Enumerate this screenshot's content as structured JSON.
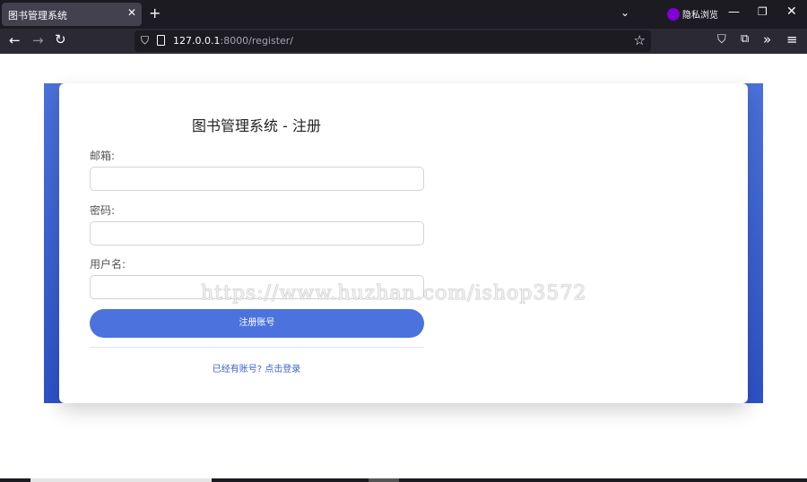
{
  "browser": {
    "tab_title": "图书管理系统",
    "tab_close": "✕",
    "new_tab": "+",
    "tabs_menu": "⌄",
    "private_label": "隐私浏览",
    "url_host": "127.0.0.1",
    "url_rest": ":8000/register/",
    "controls": {
      "minimize": "—",
      "maximize": "❐",
      "close": "✕"
    },
    "nav": {
      "back": "←",
      "forward": "→",
      "reload": "↻"
    },
    "icons": {
      "shield": "⛉",
      "star": "☆",
      "pocket": "⛉",
      "extensions": "⧉",
      "more": "»",
      "menu": "≡"
    }
  },
  "form": {
    "title": "图书管理系统 - 注册",
    "email_label": "邮箱:",
    "password_label": "密码:",
    "username_label": "用户名:",
    "submit_label": "注册账号",
    "login_link": "已经有账号? 点击登录"
  },
  "watermark": "https://www.huzhan.com/ishop3572",
  "colors": {
    "accent": "#4c73dd",
    "band": "#3a5fd0",
    "link": "#3d63c9"
  }
}
